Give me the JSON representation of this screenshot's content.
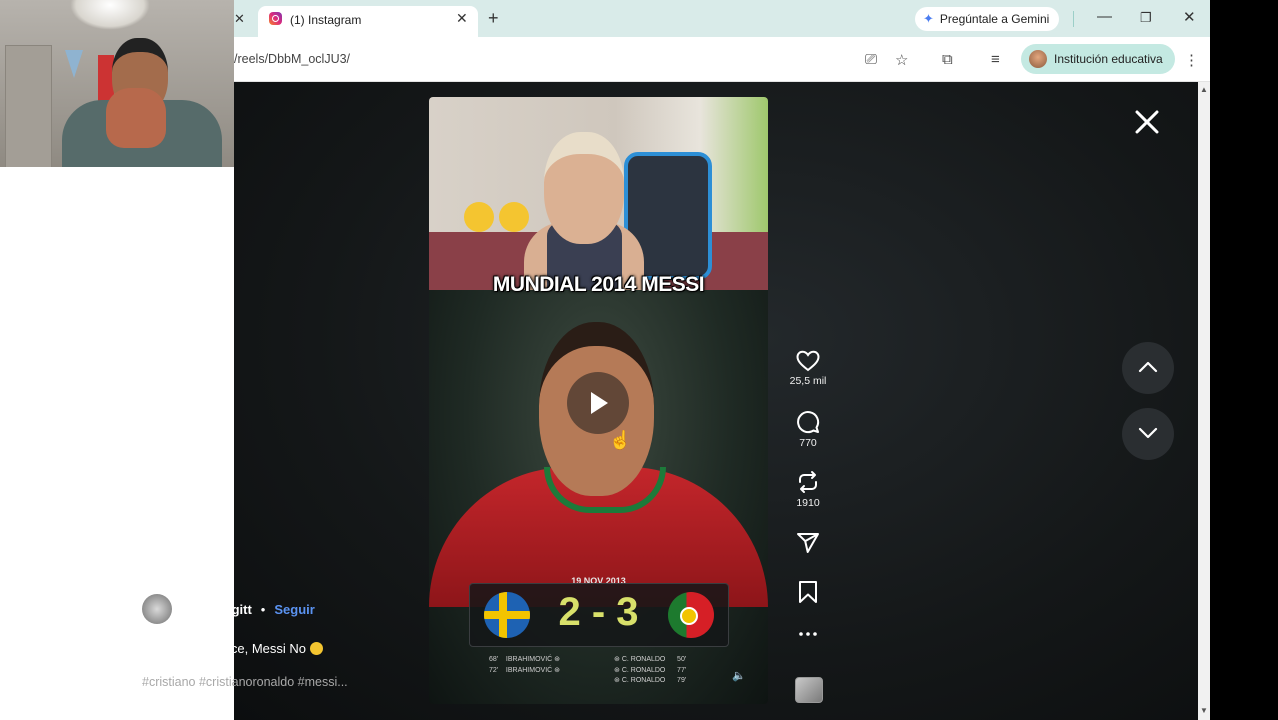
{
  "browser": {
    "tab": {
      "title": "(1) Instagram"
    },
    "new_tab_symbol": "+",
    "gemini_label": "Pregúntale a Gemini",
    "url": "/reels/DbbM_oclJU3/",
    "profile_label": "Institución educativa",
    "window_buttons": [
      "minimize",
      "restore",
      "close"
    ]
  },
  "reel": {
    "overlay_caption": "MUNDIAL 2014 MESSI",
    "scoreboard": {
      "date": "19 NOV 2013",
      "home_score": "2",
      "separator": "-",
      "away_score": "3",
      "home_scorers": [
        {
          "minute": "68'",
          "name": "IBRAHIMOVIĆ"
        },
        {
          "minute": "72'",
          "name": "IBRAHIMOVIĆ"
        }
      ],
      "away_scorers": [
        {
          "minute": "50'",
          "name": "C. RONALDO"
        },
        {
          "minute": "77'",
          "name": "C. RONALDO"
        },
        {
          "minute": "79'",
          "name": "C. RONALDO"
        }
      ]
    },
    "actions": {
      "likes": "25,5 mil",
      "comments": "770",
      "reposts": "1910"
    },
    "author": {
      "username": "tyronelegitt",
      "separator": "•",
      "follow_label": "Seguir"
    },
    "caption": "Cristiano Aparece, Messi No",
    "hashtags": "#cristiano #cristianoronaldo #messi..."
  },
  "icons": [
    "instagram-icon",
    "tab-close-icon",
    "new-tab-icon",
    "gemini-star-icon",
    "minimize-icon",
    "restore-icon",
    "window-close-icon",
    "install-icon",
    "bookmark-star-icon",
    "extensions-icon",
    "media-icon",
    "menu-kebab-icon",
    "play-icon",
    "heart-icon",
    "comment-icon",
    "repost-icon",
    "share-icon",
    "save-icon",
    "more-icon",
    "sound-icon",
    "close-icon",
    "chevron-up-icon",
    "chevron-down-icon"
  ],
  "colors": {
    "follow_link": "#5b93f2",
    "score_text": "#d8e06a",
    "browser_tab_bg": "#d9ebe9"
  }
}
